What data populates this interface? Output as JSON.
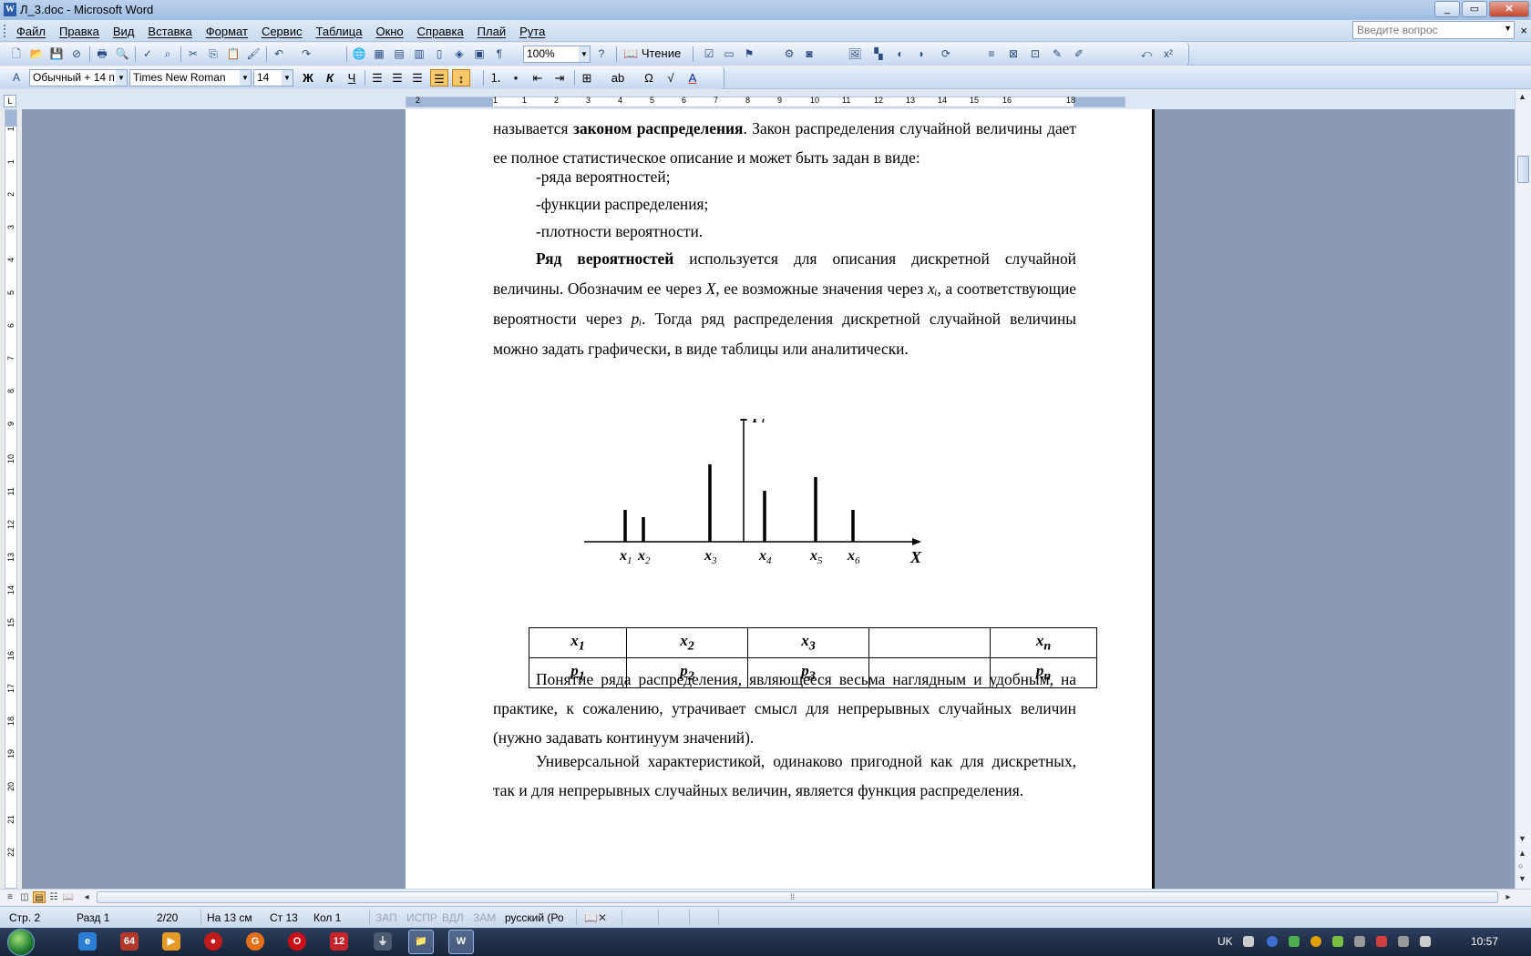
{
  "window": {
    "title": "Л_3.doc - Microsoft Word",
    "app_icon_glyph": "W"
  },
  "menu": {
    "items": [
      "Файл",
      "Правка",
      "Вид",
      "Вставка",
      "Формат",
      "Сервис",
      "Таблица",
      "Окно",
      "Справка",
      "Плай",
      "Рута"
    ],
    "ask_placeholder": "Введите вопрос",
    "close_glyph": "×"
  },
  "toolbar": {
    "zoom": "100%",
    "read_label": "Чтение",
    "style": "Обычный + 14 п",
    "font": "Times New Roman",
    "size": "14",
    "bold": "Ж",
    "italic": "К",
    "underline": "Ч"
  },
  "ruler": {
    "h_labels": [
      "2",
      "1",
      "1",
      "2",
      "3",
      "4",
      "5",
      "6",
      "7",
      "8",
      "9",
      "10",
      "11",
      "12",
      "13",
      "14",
      "15",
      "16",
      "18"
    ],
    "v_labels": [
      "1",
      "1",
      "2",
      "3",
      "4",
      "5",
      "6",
      "7",
      "8",
      "9",
      "10",
      "11",
      "12",
      "13",
      "14",
      "15",
      "16",
      "17",
      "18",
      "19",
      "20",
      "21",
      "22"
    ]
  },
  "document": {
    "line1_pre": "называется ",
    "line1_bold": "законом распределения",
    "line1_post": ". Закон распределения случайной величины дает ее полное статистическое описание и может быть задан в виде:",
    "list": [
      "-ряда вероятностей;",
      "-функции распределения;",
      "-плотности вероятности."
    ],
    "p2_bold": "Ряд вероятностей",
    "p2_a": " используется для описания дискретной случайной величины. Обозначим ее через ",
    "p2_X": "X,",
    "p2_b": " ее возможные значения через ",
    "p2_xi": "xᵢ",
    "p2_c": ", а соответствующие вероятности через ",
    "p2_pi": "pᵢ",
    "p2_d": ". Тогда ряд распределения дискретной случайной величины можно задать графически, в виде таблицы или аналитически.",
    "p3": "Понятие ряда распределения, являющееся весьма наглядным и удобным, на практике, к сожалению, утрачивает смысл для непрерывных случайных величин (нужно задавать континуум значений).",
    "p4": "Универсальной характеристикой, одинаково пригодной как для дискретных, так и для непрерывных случайных величин, является функция распределения."
  },
  "chart_data": {
    "type": "bar",
    "categories": [
      "x1",
      "x2",
      "x3",
      "x4",
      "x5",
      "x6"
    ],
    "values": [
      0.35,
      0.27,
      0.85,
      0.56,
      0.71,
      0.35
    ],
    "category_labels": [
      {
        "base": "x",
        "sub": "1"
      },
      {
        "base": "x",
        "sub": "2"
      },
      {
        "base": "x",
        "sub": "3"
      },
      {
        "base": "x",
        "sub": "4"
      },
      {
        "base": "x",
        "sub": "5"
      },
      {
        "base": "x",
        "sub": "6"
      }
    ],
    "positions": [
      -130,
      -110,
      -37,
      23,
      79,
      120
    ],
    "ylabel_base": "p",
    "ylabel_sub": "i",
    "xlabel": "X"
  },
  "table": {
    "row1": [
      {
        "b": "x",
        "s": "1"
      },
      {
        "b": "x",
        "s": "2"
      },
      {
        "b": "x",
        "s": "3"
      },
      {
        "b": "",
        "s": ""
      },
      {
        "b": "x",
        "s": "n"
      }
    ],
    "row2": [
      {
        "b": "p",
        "s": "1"
      },
      {
        "b": "p",
        "s": "2"
      },
      {
        "b": "p",
        "s": "3"
      },
      {
        "b": "",
        "s": ""
      },
      {
        "b": "p",
        "s": "n"
      }
    ]
  },
  "status": {
    "page": "Стр. 2",
    "section": "Разд 1",
    "pages": "2/20",
    "at": "На 13 см",
    "line": "Ст 13",
    "col": "Кол 1",
    "rec": "ЗАП",
    "trk": "ИСПР",
    "ext": "ВДЛ",
    "ovr": "ЗАМ",
    "lang": "русский (Ро"
  },
  "taskbar": {
    "time": "10:57",
    "lang": "UK",
    "icons": [
      "ie-icon",
      "64-icon",
      "media-icon",
      "opera-icon",
      "google-icon",
      "opera-red-icon",
      "12-icon",
      "usb-icon",
      "explorer-icon",
      "word-icon"
    ]
  }
}
